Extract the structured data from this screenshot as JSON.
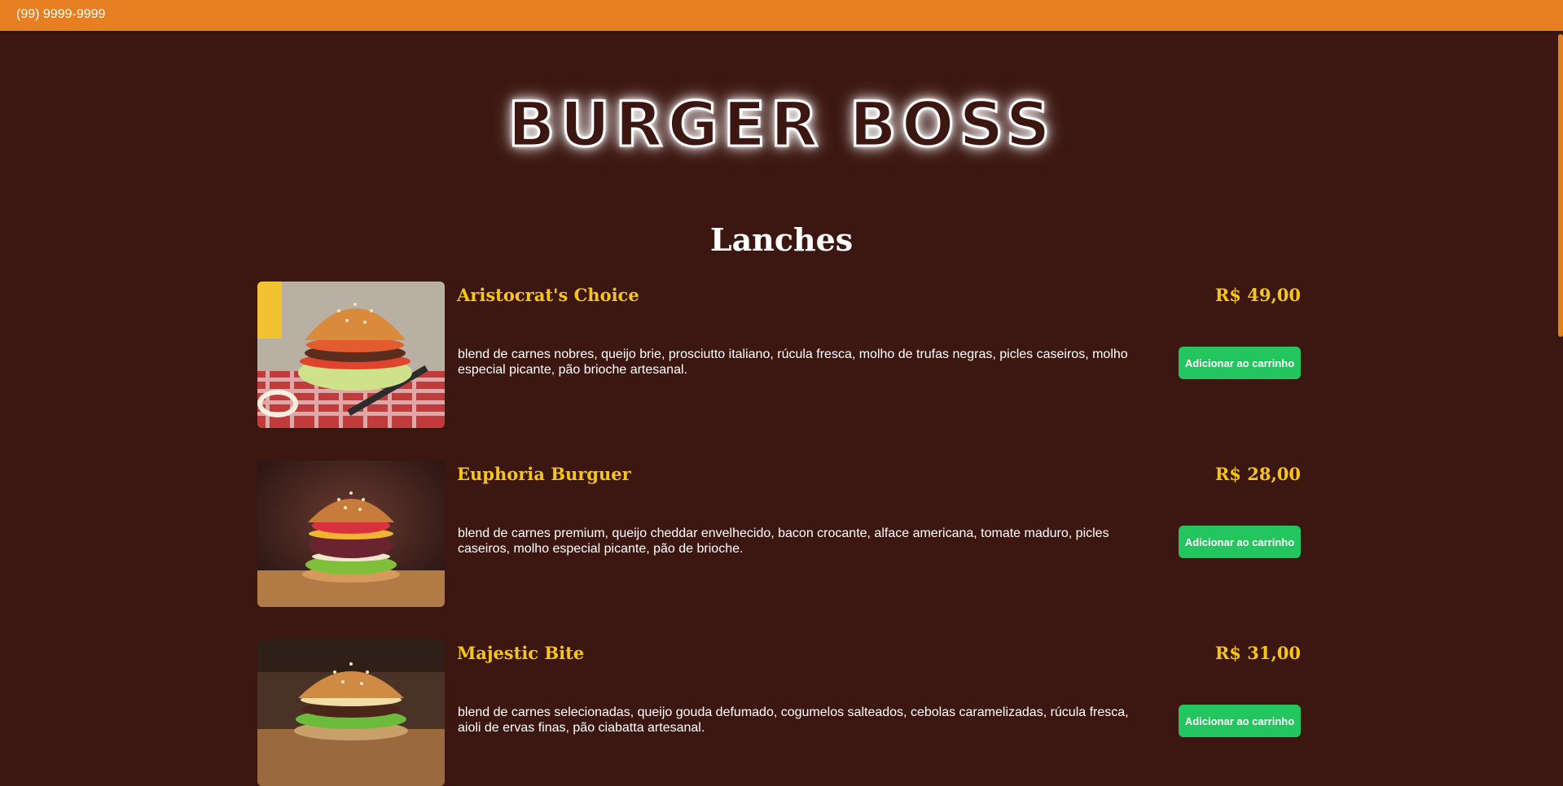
{
  "topbar": {
    "phone": "(99) 9999-9999"
  },
  "brand": {
    "title": "BURGER BOSS"
  },
  "menu": {
    "section_title": "Lanches",
    "items": [
      {
        "name": "Aristocrat's Choice",
        "price": "R$ 49,00",
        "description": "blend de carnes nobres, queijo brie, prosciutto italiano, rúcula fresca, molho de trufas negras, picles caseiros, molho especial picante, pão brioche artesanal.",
        "button": "Adicionar ao carrinho"
      },
      {
        "name": "Euphoria Burguer",
        "price": "R$ 28,00",
        "description": "blend de carnes premium, queijo cheddar envelhecido, bacon crocante, alface americana, tomate maduro, picles caseiros, molho especial picante, pão de brioche.",
        "button": "Adicionar ao carrinho"
      },
      {
        "name": "Majestic Bite",
        "price": "R$ 31,00",
        "description": "blend de carnes selecionadas, queijo gouda defumado, cogumelos salteados, cebolas caramelizadas, rúcula fresca, aioli de ervas finas, pão ciabatta artesanal.",
        "button": "Adicionar ao carrinho"
      }
    ]
  },
  "colors": {
    "background": "#3c1712",
    "topbar": "#e67e22",
    "accent_text": "#f5c518",
    "button": "#22c55e"
  }
}
